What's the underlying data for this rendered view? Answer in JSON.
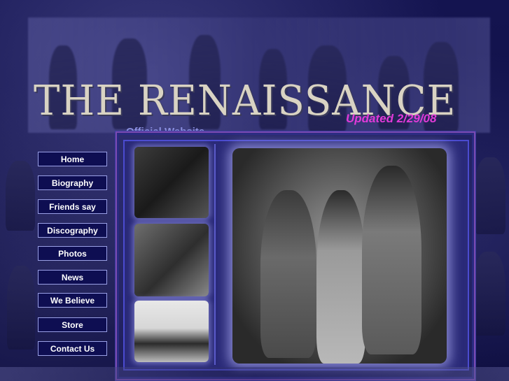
{
  "header": {
    "title": "THE RENAISSANCE",
    "updated": "Updated 2/29/08",
    "subtitle": "Official Website"
  },
  "nav": {
    "items": [
      {
        "label": "Home"
      },
      {
        "label": "Biography"
      },
      {
        "label": "Friends say"
      },
      {
        "label": "Discography"
      },
      {
        "label": "Photos"
      },
      {
        "label": "News"
      },
      {
        "label": "We Believe"
      },
      {
        "label": "Store"
      },
      {
        "label": "Contact Us"
      }
    ]
  },
  "colors": {
    "background": "#0a0a3a",
    "title": "#d9d3c3",
    "updated": "#e03ad8",
    "subtitle": "#8a8ee0",
    "nav_border": "#9aa0e6",
    "frame_accent": "#7a4ab0"
  }
}
